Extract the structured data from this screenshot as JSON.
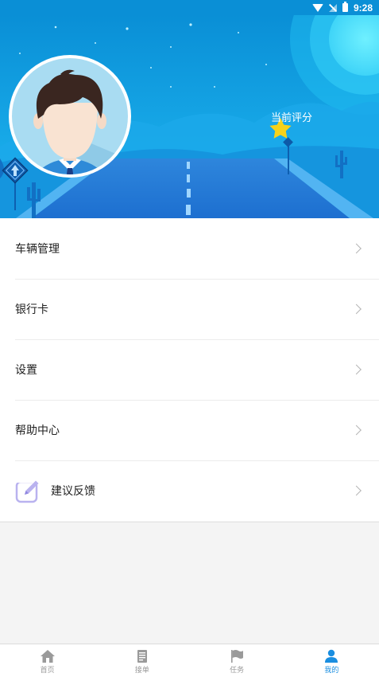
{
  "status_bar": {
    "time": "9:28"
  },
  "header": {
    "score_label": "当前评分"
  },
  "menu": {
    "items": [
      {
        "label": "车辆管理"
      },
      {
        "label": "银行卡"
      },
      {
        "label": "设置"
      },
      {
        "label": "帮助中心"
      },
      {
        "label": "建议反馈",
        "icon": "edit-icon"
      }
    ]
  },
  "tabbar": {
    "tabs": [
      {
        "label": "首页",
        "icon": "home-icon"
      },
      {
        "label": "接单",
        "icon": "document-icon"
      },
      {
        "label": "任务",
        "icon": "flag-icon"
      },
      {
        "label": "我的",
        "icon": "user-icon"
      }
    ],
    "active_index": 3
  },
  "colors": {
    "sky_top": "#0a8fd6",
    "sky_bottom": "#1bb6f0",
    "accent": "#1a8ee0",
    "star": "#f7d21a",
    "icon_lavender": "#b9b2ef"
  }
}
